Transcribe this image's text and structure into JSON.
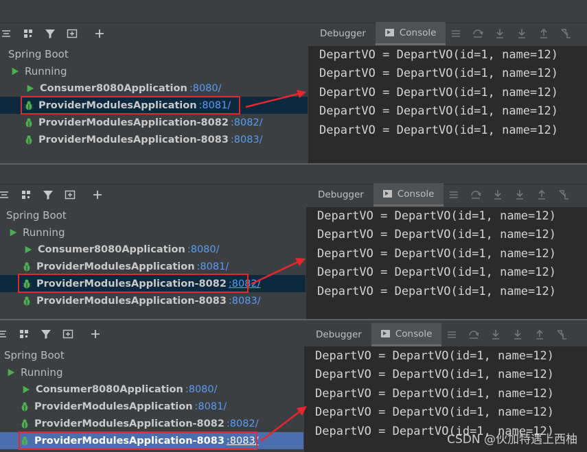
{
  "tree": {
    "spring_boot": "Spring Boot",
    "running": "Running",
    "apps": [
      {
        "name": "Consumer8080Application",
        "port": ":8080/"
      },
      {
        "name": "ProviderModulesApplication",
        "port": ":8081/"
      },
      {
        "name": "ProviderModulesApplication-8082",
        "port": ":8082/"
      },
      {
        "name": "ProviderModulesApplication-8083",
        "port": ":8083/"
      }
    ]
  },
  "tabs": {
    "debugger": "Debugger",
    "console": "Console"
  },
  "console_lines": [
    "DepartVO = DepartVO(id=1, name=12)",
    "DepartVO = DepartVO(id=1, name=12)",
    "DepartVO = DepartVO(id=1, name=12)",
    "DepartVO = DepartVO(id=1, name=12)",
    "DepartVO = DepartVO(id=1, name=12)"
  ],
  "watermark": "CSDN @伙加特遇上西柚",
  "colors": {
    "highlight": "#e8262e",
    "port_link": "#589df6",
    "selection": "#0d293e",
    "selection_focused": "#4b6eaf"
  }
}
